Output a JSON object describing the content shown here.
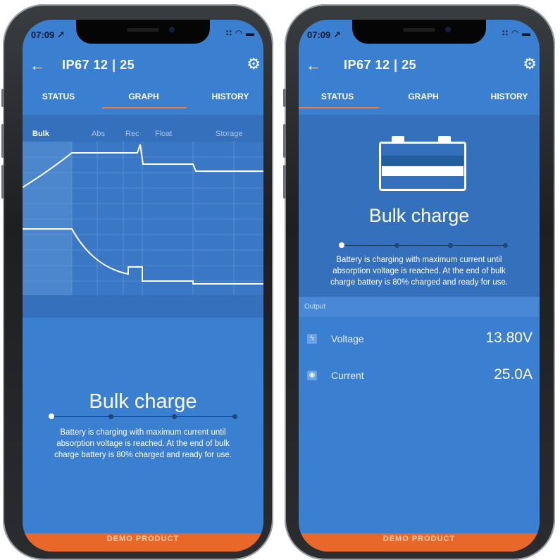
{
  "status_bar": {
    "time": "07:09 ↗",
    "icons": "∷ ◠ ▬"
  },
  "header": {
    "title": "IP67 12 | 25"
  },
  "tabs": [
    "STATUS",
    "GRAPH",
    "HISTORY"
  ],
  "graph": {
    "phases": [
      "Bulk",
      "Abs",
      "Rec",
      "Float",
      "Storage"
    ]
  },
  "charge": {
    "title": "Bulk charge",
    "description_lines": [
      "Battery is charging with maximum current until",
      "absorption voltage is reached. At the end of bulk",
      "charge battery is 80% charged and ready for use."
    ]
  },
  "output": {
    "section_label": "Output",
    "voltage": {
      "label": "Voltage",
      "value": "13.80V"
    },
    "current": {
      "label": "Current",
      "value": "25.0A"
    }
  },
  "demo_banner": "DEMO PRODUCT",
  "colors": {
    "screen_bg": "#3b7fd1",
    "panel_bg": "#3570bd",
    "accent": "#f47b2c",
    "banner": "#e8682a"
  }
}
